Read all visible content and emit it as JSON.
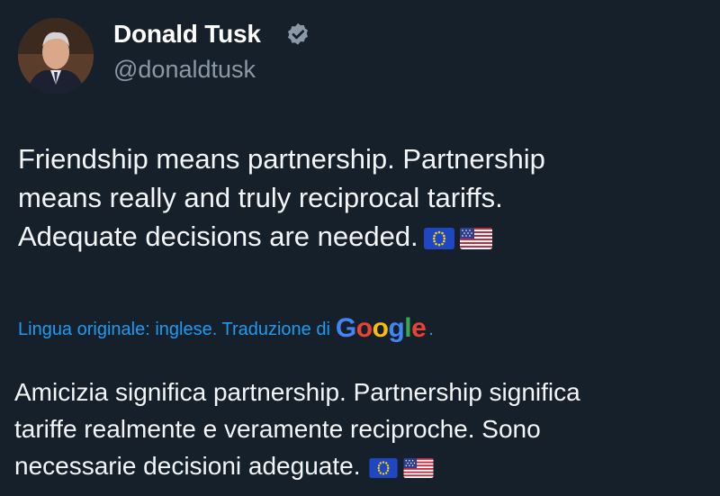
{
  "author": {
    "display_name": "Donald Tusk",
    "handle": "@donaldtusk",
    "verified_icon": "verified-badge-icon"
  },
  "tweet": {
    "lines": [
      "Friendship means partnership. Partnership",
      "means really and truly reciprocal tariffs.",
      "Adequate decisions are needed."
    ],
    "flags": [
      "eu-flag-icon",
      "us-flag-icon"
    ]
  },
  "translation": {
    "notice": "Lingua originale: inglese. Traduzione di",
    "provider_letters": [
      "G",
      "o",
      "o",
      "g",
      "l",
      "e"
    ],
    "suffix": ".",
    "lines": [
      "Amicizia significa partnership. Partnership significa",
      "tariffe realmente e veramente reciproche. Sono",
      "necessarie decisioni adeguate."
    ]
  },
  "colors": {
    "background": "#15202b",
    "link": "#1d9bf0",
    "muted": "#8b98a5"
  }
}
